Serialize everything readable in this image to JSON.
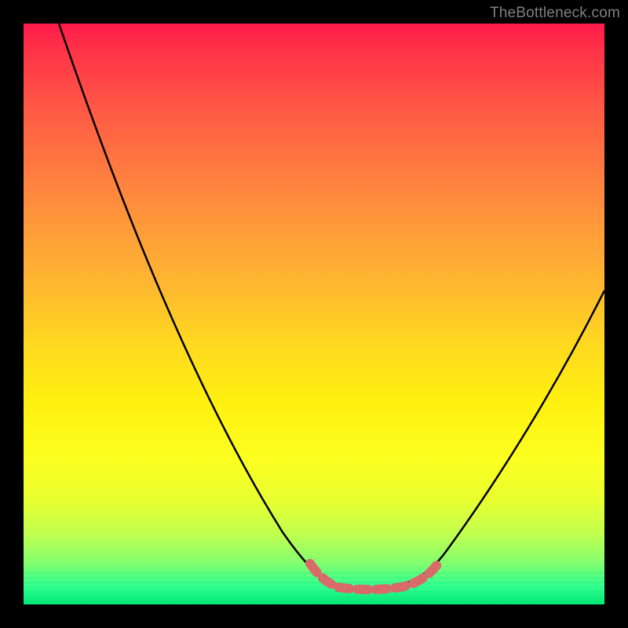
{
  "attribution": "TheBottleneck.com",
  "colors": {
    "gradient_top": "#ff1a4a",
    "gradient_mid": "#ffd820",
    "gradient_bottom": "#00e878",
    "curve": "#000000",
    "marker": "#d96a6a",
    "background": "#000000",
    "attribution_text": "#808080"
  },
  "chart_data": {
    "type": "line",
    "title": "",
    "xlabel": "",
    "ylabel": "",
    "xlim": [
      0,
      100
    ],
    "ylim": [
      0,
      100
    ],
    "series": [
      {
        "name": "bottleneck-curve",
        "x": [
          6,
          14,
          22,
          30,
          38,
          45,
          50,
          55,
          58,
          62,
          68,
          75,
          82,
          90,
          100
        ],
        "y": [
          100,
          80,
          60,
          42,
          28,
          15,
          7,
          3,
          2,
          3,
          8,
          18,
          32,
          46,
          58
        ]
      }
    ],
    "marker_range": {
      "name": "optimal-range",
      "x_start": 49,
      "x_end": 71,
      "y_approx": 3
    },
    "background_gradient": {
      "direction": "vertical",
      "stops": [
        {
          "pos": 0,
          "color": "#ff1a4a"
        },
        {
          "pos": 50,
          "color": "#ffd820"
        },
        {
          "pos": 100,
          "color": "#00e878"
        }
      ]
    }
  }
}
